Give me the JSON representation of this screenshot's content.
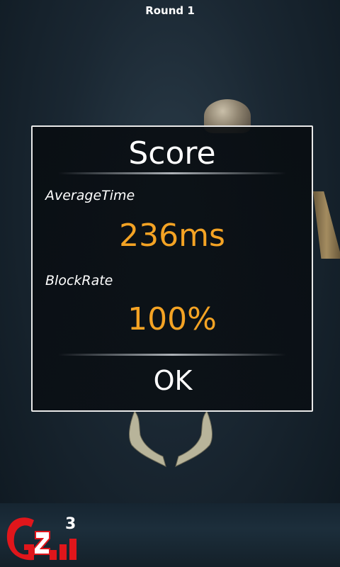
{
  "hud": {
    "round": "Round 1"
  },
  "dialog": {
    "title": "Score",
    "average_time_label": "AverageTime",
    "average_time_value": "236ms",
    "block_rate_label": "BlockRate",
    "block_rate_value": "100%",
    "ok_label": "OK"
  },
  "logo": {
    "icon": "g3-logo-icon",
    "text": "G3"
  },
  "colors": {
    "value_accent": "#f4a324",
    "border": "#e9e9e9",
    "logo_red": "#e0161b"
  }
}
